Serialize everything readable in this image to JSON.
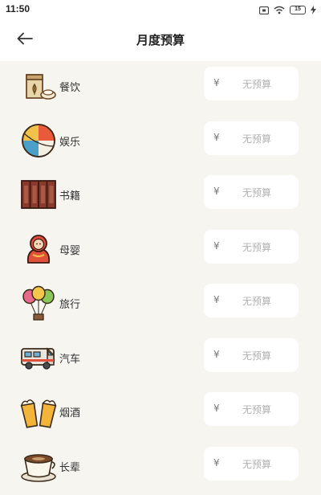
{
  "status_bar": {
    "time": "11:50",
    "battery": "15"
  },
  "header": {
    "title": "月度预算"
  },
  "budget": {
    "currency_symbol": "¥",
    "placeholder": "无预算"
  },
  "categories": [
    {
      "label": "餐饮",
      "icon": "food-icon"
    },
    {
      "label": "娱乐",
      "icon": "beach-ball-icon"
    },
    {
      "label": "书籍",
      "icon": "books-icon"
    },
    {
      "label": "母婴",
      "icon": "baby-doll-icon"
    },
    {
      "label": "旅行",
      "icon": "balloons-icon"
    },
    {
      "label": "汽车",
      "icon": "rv-car-icon"
    },
    {
      "label": "烟酒",
      "icon": "beer-icon"
    },
    {
      "label": "长辈",
      "icon": "coffee-cup-icon"
    }
  ]
}
